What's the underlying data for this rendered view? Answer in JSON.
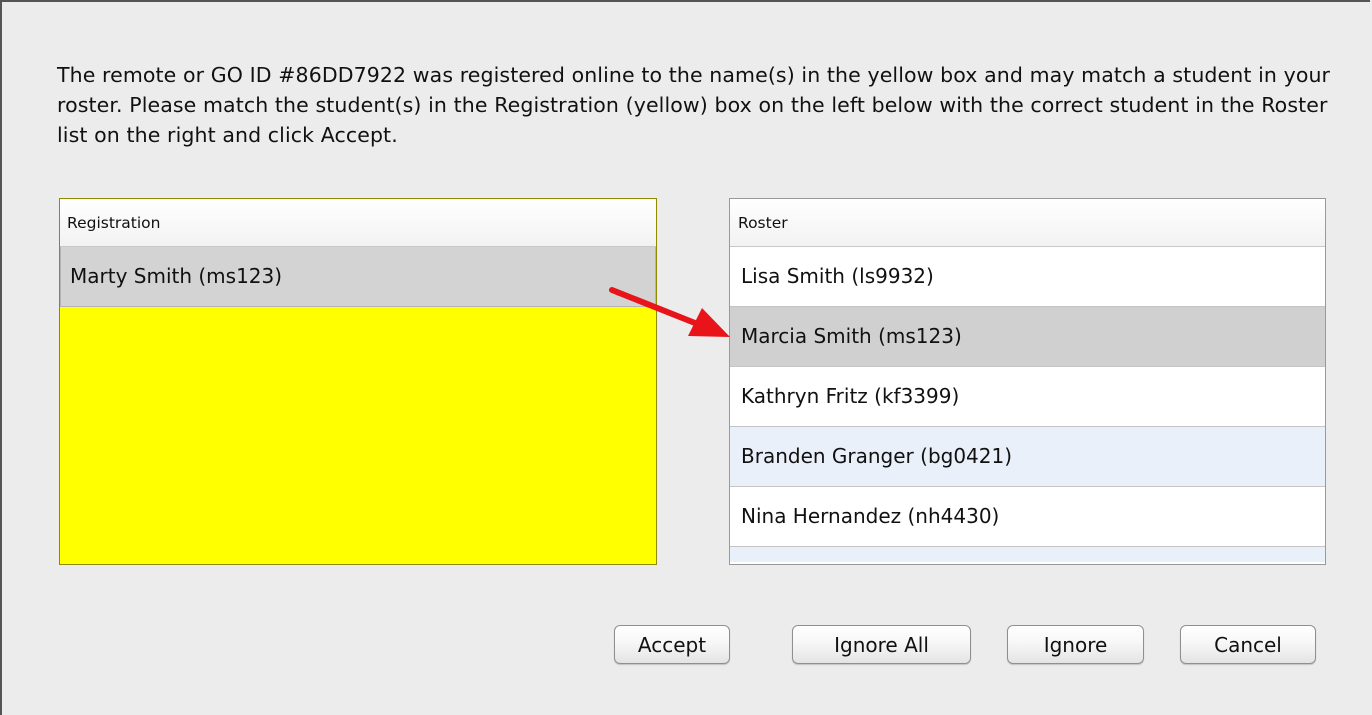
{
  "instructions": "The remote or GO ID #86DD7922 was registered online to the name(s) in the yellow box and may match a student in your roster. Please match the student(s) in the Registration (yellow) box on the left below with the correct student in the Roster list on the right and click Accept.",
  "registration": {
    "header": "Registration",
    "items": [
      "Marty Smith (ms123)"
    ]
  },
  "roster": {
    "header": "Roster",
    "items": [
      "Lisa Smith (ls9932)",
      "Marcia Smith (ms123)",
      "Kathryn Fritz (kf3399)",
      "Branden Granger (bg0421)",
      "Nina Hernandez (nh4430)"
    ],
    "selected": "Marcia Smith (ms123)"
  },
  "buttons": {
    "accept": "Accept",
    "ignore_all": "Ignore All",
    "ignore": "Ignore",
    "cancel": "Cancel"
  },
  "colors": {
    "registration_bg": "#ffff00",
    "arrow": "#e8141a",
    "selected_row": "#d0d0d0"
  }
}
